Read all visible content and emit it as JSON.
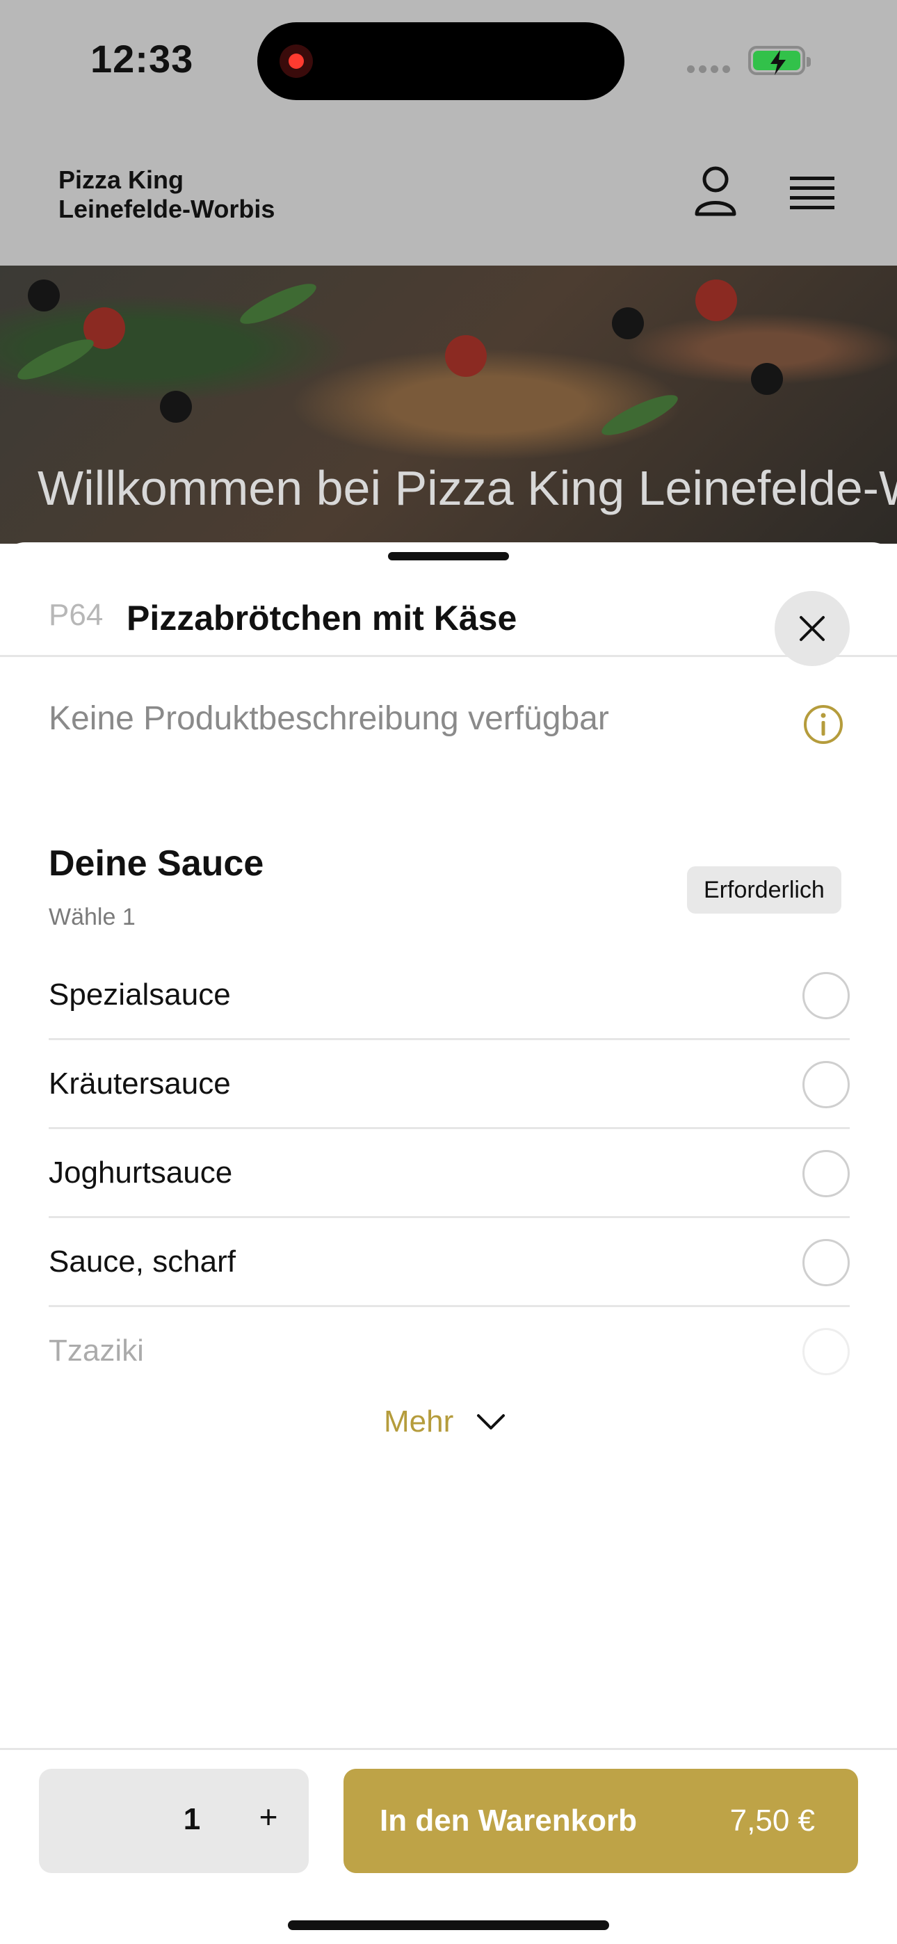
{
  "status": {
    "time": "12:33"
  },
  "header": {
    "shop_name_line1": "Pizza King",
    "shop_name_line2": "Leinefelde-Worbis"
  },
  "hero": {
    "title": "Willkommen bei Pizza King Leinefelde-Worbis"
  },
  "sheet": {
    "code": "P64",
    "title": "Pizzabrötchen mit Käse",
    "description": "Keine Produktbeschreibung verfügbar",
    "section": {
      "title": "Deine Sauce",
      "subtitle": "Wähle 1",
      "badge": "Erforderlich",
      "options": [
        {
          "label": "Spezialsauce"
        },
        {
          "label": "Kräutersauce"
        },
        {
          "label": "Joghurtsauce"
        },
        {
          "label": "Sauce, scharf"
        },
        {
          "label": "Tzaziki"
        }
      ],
      "more_label": "Mehr"
    },
    "footer": {
      "quantity": "1",
      "plus": "+",
      "cart_label": "In den Warenkorb",
      "price": "7,50 €"
    }
  },
  "colors": {
    "accent": "#bea347",
    "accent_text": "#b59c3c",
    "overlay": "#b8b8b8"
  }
}
